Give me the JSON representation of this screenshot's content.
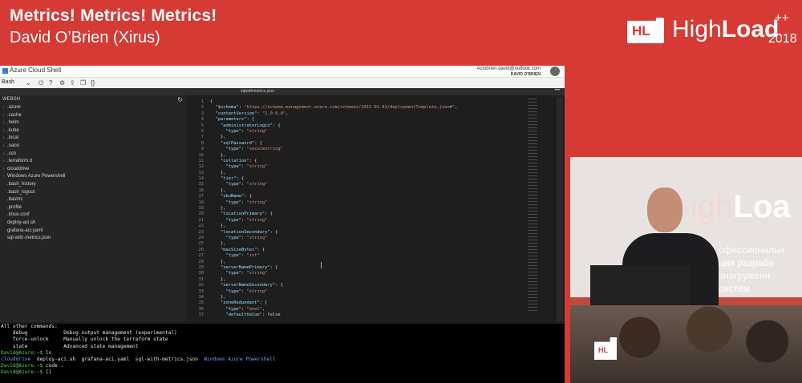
{
  "slide": {
    "title": "Metrics! Metrics! Metrics!",
    "subtitle": "David O’Brien (Xirus)"
  },
  "logo": {
    "mark": "HL",
    "word_a": "High",
    "word_b": "Load",
    "plus": "++",
    "year": "2018"
  },
  "shell": {
    "app_title": "Azure Cloud Shell",
    "account_email": "Aclobrien.david@outlook.com",
    "account_name": "DAVID O'BRIEN",
    "shell_type": "Bash",
    "file_tab": "sqlwithmetrics.json",
    "explorer_header": "WEBSH",
    "explorer_items": [
      {
        "label": ".azure",
        "folder": true
      },
      {
        "label": ".cache",
        "folder": true
      },
      {
        "label": ".helm",
        "folder": true
      },
      {
        "label": ".kube",
        "folder": true
      },
      {
        "label": ".local",
        "folder": true
      },
      {
        "label": ".nano",
        "folder": true
      },
      {
        "label": ".ssh",
        "folder": true
      },
      {
        "label": ".terraform.d",
        "folder": true
      },
      {
        "label": "clouddrive",
        "folder": true
      },
      {
        "label": "Windows Azure Powershell",
        "folder": true
      },
      {
        "label": ".bash_history",
        "folder": false
      },
      {
        "label": ".bash_logout",
        "folder": false
      },
      {
        "label": ".bashrc",
        "folder": false
      },
      {
        "label": ".profile",
        "folder": false
      },
      {
        "label": ".tmux.conf",
        "folder": false
      },
      {
        "label": "deploy-aci.sh",
        "folder": false
      },
      {
        "label": "grafana-aci.yaml",
        "folder": false
      },
      {
        "label": "sql-with-metrics.json",
        "folder": false
      }
    ],
    "code_lines": [
      "{",
      "  \"$schema\": \"https://schema.management.azure.com/schemas/2015-01-01/deploymentTemplate.json#\",",
      "  \"contentVersion\": \"1.0.0.0\",",
      "  \"parameters\": {",
      "    \"administratorLogin\": {",
      "      \"type\": \"string\"",
      "    },",
      "    \"sqlPassword\": {",
      "      \"type\": \"securestring\"",
      "    },",
      "    \"collation\": {",
      "      \"type\": \"string\"",
      "    },",
      "    \"tier\": {",
      "      \"type\": \"string\"",
      "    },",
      "    \"skuName\": {",
      "      \"type\": \"string\"",
      "    },",
      "    \"locationPrimary\": {",
      "      \"type\": \"string\"",
      "    },",
      "    \"locationSecondary\": {",
      "      \"type\": \"string\"",
      "    },",
      "    \"maxSizeBytes\": {",
      "      \"type\": \"int\"",
      "    },",
      "    \"serverNamePrimary\": {",
      "      \"type\": \"string\"",
      "    },",
      "    \"serverNameSecondary\": {",
      "      \"type\": \"string\"",
      "    },",
      "    \"zoneRedundant\": {",
      "      \"type\": \"bool\",",
      "      \"defaultValue\": false"
    ],
    "terminal": {
      "lines": [
        {
          "text": "All other commands:",
          "color": "default"
        },
        {
          "text": "    debug            Debug output management (experimental)",
          "color": "default"
        },
        {
          "text": "    force-unlock     Manually unlock the terraform state",
          "color": "default"
        },
        {
          "text": "    state            Advanced state management",
          "color": "default"
        },
        {
          "text": "David@Azure:~$ ls",
          "color": "prompt"
        },
        {
          "text": "clouddrive  deploy-aci.sh  grafana-aci.yaml  sql-with-metrics.json  Windows Azure Powershell",
          "color": "listing"
        },
        {
          "text": "David@Azure:~$ code .",
          "color": "prompt"
        },
        {
          "text": "David@Azure:~$ []",
          "color": "prompt"
        }
      ]
    }
  },
  "video": {
    "wall_text_a": "igh",
    "wall_text_b": "Loa",
    "wall_ru": [
      "офессиональн",
      "ция разрабо",
      "энагруженн",
      "систем"
    ],
    "badge": "HL"
  },
  "colors": {
    "background": "#d63a35",
    "editor_bg": "#1e1e1e",
    "terminal_bg": "#000000"
  }
}
